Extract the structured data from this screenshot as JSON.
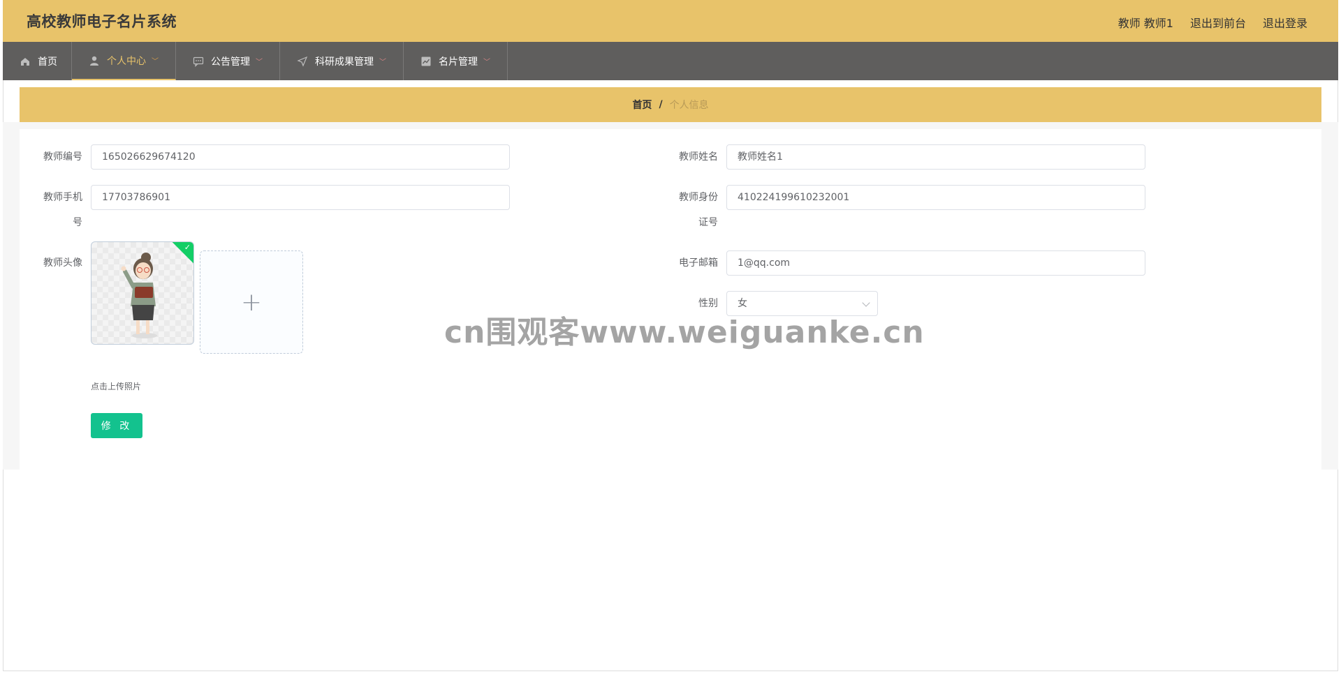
{
  "header": {
    "app_title": "高校教师电子名片系统",
    "user_label": "教师 教师1",
    "links": [
      "退出到前台",
      "退出登录"
    ]
  },
  "nav": {
    "items": [
      {
        "label": "首页",
        "icon": "home-icon"
      },
      {
        "label": "个人中心",
        "icon": "user-icon",
        "active": true
      },
      {
        "label": "公告管理",
        "icon": "chat-icon"
      },
      {
        "label": "科研成果管理",
        "icon": "send-icon"
      },
      {
        "label": "名片管理",
        "icon": "chart-icon"
      }
    ]
  },
  "breadcrumb": {
    "home": "首页",
    "separator": "/",
    "current": "个人信息"
  },
  "form": {
    "teacher_no": {
      "label": "教师编号",
      "value": "165026629674120"
    },
    "teacher_name": {
      "label": "教师姓名",
      "value": "教师姓名1"
    },
    "phone": {
      "label_line1": "教师手机",
      "label_line2": "号",
      "value": "17703786901"
    },
    "id_card": {
      "label_line1": "教师身份",
      "label_line2": "证号",
      "value": "410224199610232001"
    },
    "avatar": {
      "label": "教师头像",
      "hint": "点击上传照片"
    },
    "email": {
      "label": "电子邮箱",
      "value": "1@qq.com"
    },
    "gender": {
      "label": "性别",
      "value": "女"
    },
    "submit_label": "修 改"
  },
  "watermark": "cn围观客www.weiguanke.cn",
  "colors": {
    "accent": "#e8c36a",
    "nav_bg": "#5f5e5d",
    "button": "#13c28e"
  }
}
